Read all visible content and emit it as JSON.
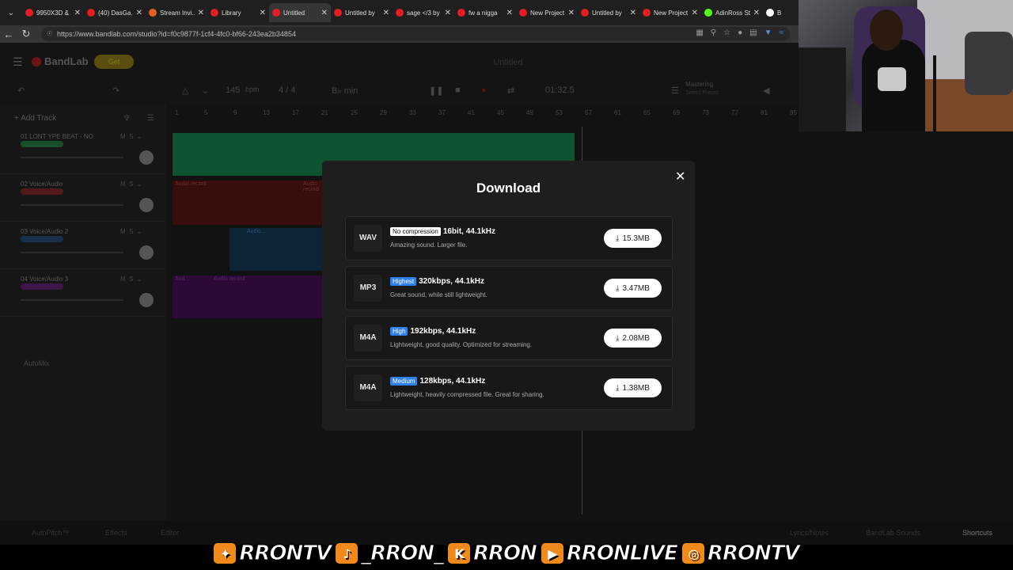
{
  "browser": {
    "tabs": [
      {
        "title": "9950X3D & ...",
        "color": "#e02020"
      },
      {
        "title": "(40) DasGa...",
        "color": "#e02020"
      },
      {
        "title": "Stream Invi...",
        "color": "#e06020"
      },
      {
        "title": "Library",
        "color": "#e02020"
      },
      {
        "title": "Untitled",
        "color": "#e02020",
        "active": true
      },
      {
        "title": "Untitled by",
        "color": "#e02020"
      },
      {
        "title": "sage </3 by",
        "color": "#e02020"
      },
      {
        "title": "fw a nigga",
        "color": "#e02020"
      },
      {
        "title": "New Project",
        "color": "#e02020"
      },
      {
        "title": "Untitled by",
        "color": "#e02020"
      },
      {
        "title": "New Project",
        "color": "#e02020"
      },
      {
        "title": "AdinRoss St",
        "color": "#53fc18"
      },
      {
        "title": "B",
        "color": "#ffffff"
      }
    ],
    "url": "https://www.bandlab.com/studio?id=f0c9877f-1cf4-4fc0-bf66-243ea2b34854"
  },
  "app": {
    "brand": "BandLab",
    "get_label": "Get",
    "project_title": "Untitled",
    "bpm": "145",
    "bpm_unit": "bpm",
    "time_sig": "4 / 4",
    "key": "B♭ min",
    "time": "01:32.5",
    "mastering": "Mastering",
    "mastering_sub": "Select Preset",
    "add_track": "Add Track",
    "tracks": [
      {
        "name": "01  LONT YPE BEAT - NO",
        "tag_color": "#1db954"
      },
      {
        "name": "02  Voice/Audio",
        "tag_color": "#c02020"
      },
      {
        "name": "03  Voice/Audio 2",
        "tag_color": "#1e5fa8"
      },
      {
        "name": "04  Voice/Audio 3",
        "tag_color": "#8a16a8"
      }
    ],
    "automix": "AutoMix",
    "ruler": [
      "1",
      "5",
      "9",
      "13",
      "17",
      "21",
      "25",
      "29",
      "33",
      "37",
      "41",
      "45",
      "49",
      "53",
      "57",
      "61",
      "65",
      "69",
      "73",
      "77",
      "81",
      "85"
    ],
    "clip_labels": [
      "Audio record",
      "Audio record",
      "Audio...",
      "Aud...",
      "Audio record"
    ],
    "bottom": {
      "autopitch": "AutoPitch™",
      "effects": "Effects",
      "editor": "Editor",
      "lyrics": "Lyrics/Notes",
      "sounds": "BandLab Sounds",
      "shortcuts": "Shortcuts"
    }
  },
  "modal": {
    "title": "Download",
    "options": [
      {
        "format": "WAV",
        "badge": "No compression",
        "badge_style": "white",
        "spec": "16bit, 44.1kHz",
        "desc": "Amazing sound. Larger file.",
        "size": "15.3MB"
      },
      {
        "format": "MP3",
        "badge": "Highest",
        "badge_style": "blue",
        "spec": "320kbps, 44.1kHz",
        "desc": "Great sound, while still lightweight.",
        "size": "3.47MB"
      },
      {
        "format": "M4A",
        "badge": "High",
        "badge_style": "blue",
        "spec": "192kbps, 44.1kHz",
        "desc": "Lightweight, good quality. Optimized for streaming.",
        "size": "2.08MB"
      },
      {
        "format": "M4A",
        "badge": "Medium",
        "badge_style": "blue",
        "spec": "128kbps, 44.1kHz",
        "desc": "Lightweight, heavily compressed file. Great for sharing.",
        "size": "1.38MB"
      }
    ]
  },
  "social": [
    {
      "icon": "twitter-icon",
      "glyph": "✦",
      "bg": "#f08a1a",
      "handle": "RRONTV"
    },
    {
      "icon": "tiktok-icon",
      "glyph": "♪",
      "bg": "#f08a1a",
      "handle": "_RRON_"
    },
    {
      "icon": "kick-icon",
      "glyph": "K",
      "bg": "#f08a1a",
      "handle": "RRON"
    },
    {
      "icon": "youtube-icon",
      "glyph": "▶",
      "bg": "#f08a1a",
      "handle": "RRONLIVE"
    },
    {
      "icon": "instagram-icon",
      "glyph": "◎",
      "bg": "#f08a1a",
      "handle": "RRONTV"
    }
  ],
  "colors": {
    "accent_blue": "#2f80ed",
    "modal_bg": "#1e1e1e"
  }
}
